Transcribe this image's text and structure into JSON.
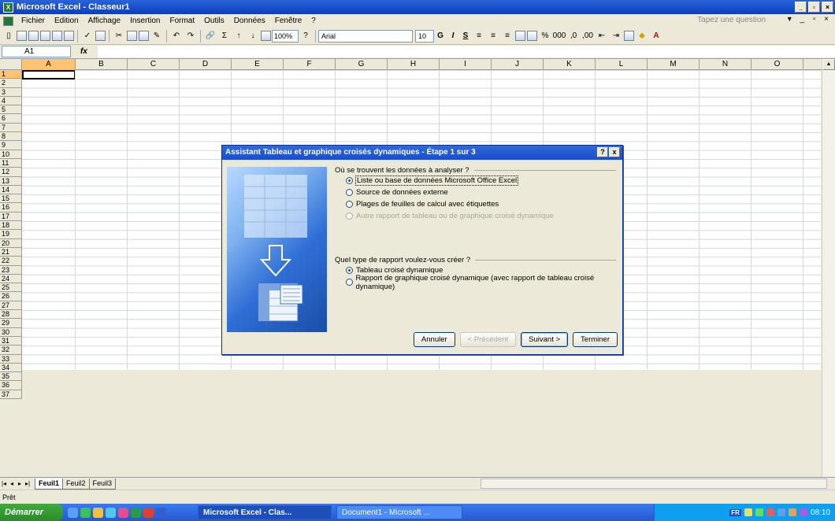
{
  "window": {
    "title": "Microsoft Excel - Classeur1"
  },
  "menu": {
    "items": [
      "Fichier",
      "Edition",
      "Affichage",
      "Insertion",
      "Format",
      "Outils",
      "Données",
      "Fenêtre",
      "?"
    ],
    "help_placeholder": "Tapez une question"
  },
  "toolbar": {
    "zoom": "100%",
    "font": "Arial",
    "size": "10",
    "bold": "G",
    "italic": "I",
    "underline": "S"
  },
  "formula_bar": {
    "name_box": "A1",
    "fx": "fx"
  },
  "columns": [
    "A",
    "B",
    "C",
    "D",
    "E",
    "F",
    "G",
    "H",
    "I",
    "J",
    "K",
    "L",
    "M",
    "N",
    "O"
  ],
  "rows": [
    "1",
    "2",
    "3",
    "4",
    "5",
    "6",
    "7",
    "8",
    "9",
    "10",
    "11",
    "12",
    "13",
    "14",
    "15",
    "16",
    "17",
    "18",
    "19",
    "20",
    "21",
    "22",
    "23",
    "24",
    "25",
    "26",
    "27",
    "28",
    "29",
    "30",
    "31",
    "32",
    "33",
    "34",
    "35",
    "36",
    "37"
  ],
  "sheets": [
    "Feuil1",
    "Feuil2",
    "Feuil3"
  ],
  "status": "Prêt",
  "dialog": {
    "title": "Assistant Tableau et graphique croisés dynamiques - Étape 1 sur 3",
    "help_btn": "?",
    "close_btn": "x",
    "q1": "Où se trouvent les données à analyser ?",
    "q1_options": [
      "Liste ou base de données Microsoft Office Excel",
      "Source de données externe",
      "Plages de feuilles de calcul avec étiquettes",
      "Autre rapport de tableau ou de graphique croisé dynamique"
    ],
    "q2": "Quel type de rapport voulez-vous créer ?",
    "q2_options": [
      "Tableau croisé dynamique",
      "Rapport de graphique croisé dynamique (avec rapport de tableau croisé dynamique)"
    ],
    "buttons": {
      "cancel": "Annuler",
      "prev": "< Précédent",
      "next": "Suivant >",
      "finish": "Terminer"
    }
  },
  "taskbar": {
    "start": "Démarrer",
    "tasks": [
      "Microsoft Excel - Clas...",
      "Document1 - Microsoft ..."
    ],
    "lang": "FR",
    "clock": "08:10"
  }
}
